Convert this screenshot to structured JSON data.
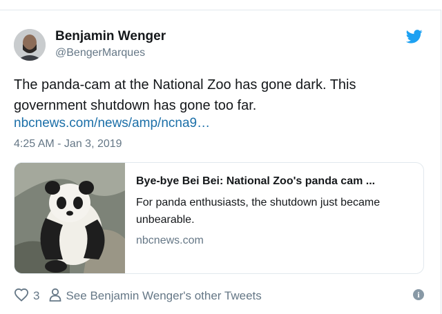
{
  "tweet": {
    "author_name": "Benjamin Wenger",
    "author_handle": "@BengerMarques",
    "text_line1": "The panda-cam at the National Zoo has gone dark.  This",
    "text_line2": "government shutdown has gone too far.",
    "link_text": "nbcnews.com/news/amp/ncna9…",
    "timestamp": "4:25 AM - Jan 3, 2019"
  },
  "link_card": {
    "title": "Bye-bye Bei Bei: National Zoo's panda cam ...",
    "description": "For panda enthusiasts, the shutdown just became unbearable.",
    "domain": "nbcnews.com"
  },
  "footer": {
    "like_count": "3",
    "other_tweets_label": "See Benjamin Wenger's other Tweets"
  },
  "icons": {
    "brand": "twitter-bird-icon",
    "like": "heart-icon",
    "profile": "person-icon",
    "info": "info-icon"
  },
  "colors": {
    "twitter_blue": "#1da1f2",
    "link": "#1b6fa8",
    "secondary_text": "#657786",
    "border": "#e1e8ed"
  }
}
